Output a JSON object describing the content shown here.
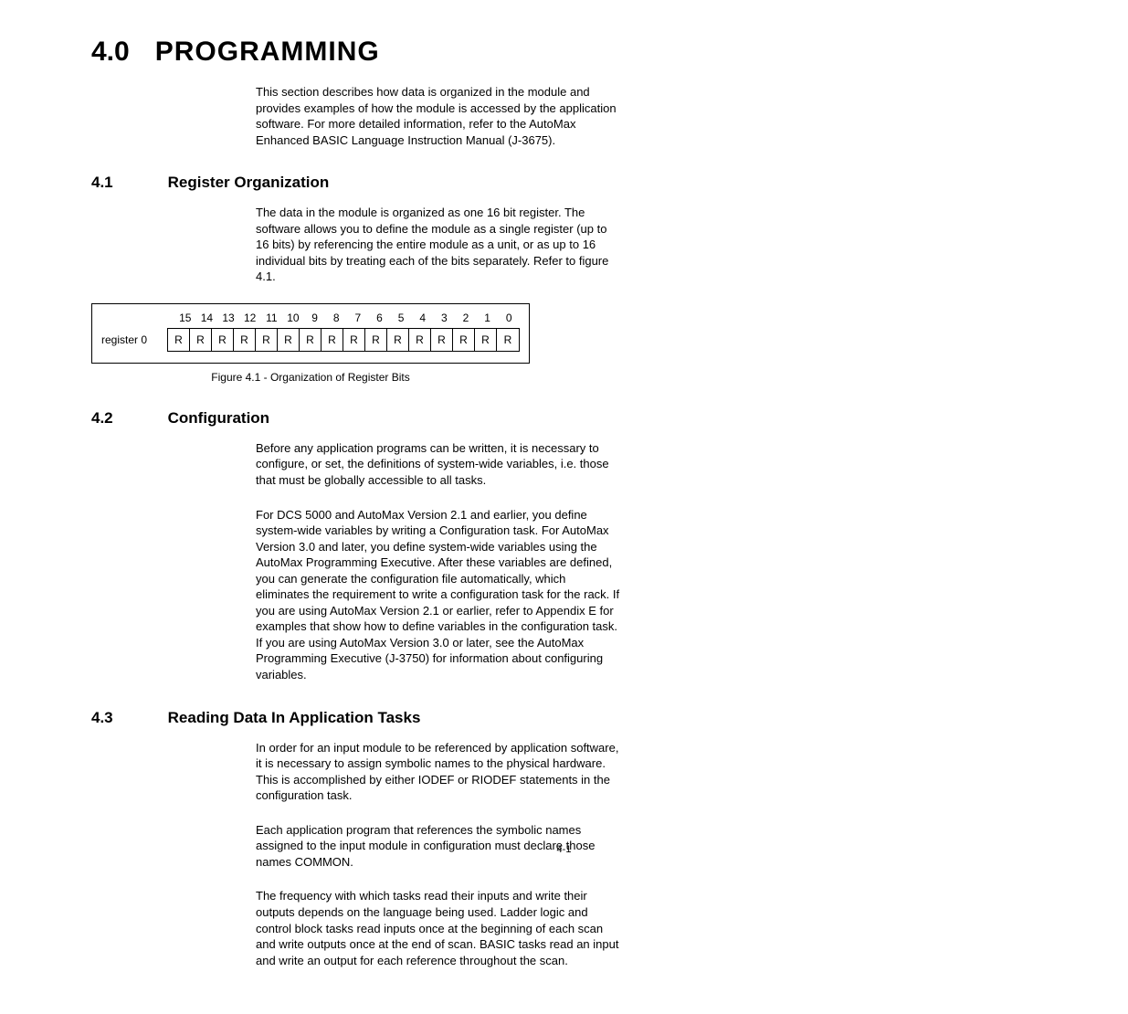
{
  "heading": {
    "number": "4.0",
    "title": "PROGRAMMING",
    "intro": "This section describes how data is organized in the module and provides examples of how the module is accessed by the application software. For more detailed information, refer to the AutoMax Enhanced BASIC Language Instruction Manual (J-3675)."
  },
  "section41": {
    "number": "4.1",
    "title": "Register Organization",
    "body": "The data in the module is organized as one 16 bit register. The software allows you to define the module as a single register (up to 16 bits) by referencing the entire module as a unit, or as up to 16 individual bits by treating each of the bits separately. Refer to figure 4.1."
  },
  "figure41": {
    "register_label": "register 0",
    "bits": [
      "15",
      "14",
      "13",
      "12",
      "11",
      "10",
      "9",
      "8",
      "7",
      "6",
      "5",
      "4",
      "3",
      "2",
      "1",
      "0"
    ],
    "cells": [
      "R",
      "R",
      "R",
      "R",
      "R",
      "R",
      "R",
      "R",
      "R",
      "R",
      "R",
      "R",
      "R",
      "R",
      "R",
      "R"
    ],
    "caption": "Figure 4.1 - Organization of Register Bits"
  },
  "section42": {
    "number": "4.2",
    "title": "Configuration",
    "p1": "Before any application programs can be written, it is necessary to configure, or set, the definitions of system-wide variables, i.e. those that must be globally accessible to all tasks.",
    "p2": "For DCS 5000 and AutoMax Version 2.1 and earlier, you define system-wide variables by writing a Configuration task. For AutoMax Version 3.0 and later, you define system-wide variables using the AutoMax Programming Executive. After these variables are defined, you can generate the configuration file automatically, which eliminates the requirement to write a configuration task for the rack. If you are using AutoMax Version 2.1 or earlier, refer to Appendix E for examples that show how to define variables in the configuration task. If you are using AutoMax Version 3.0 or later, see the AutoMax Programming Executive (J-3750) for information about configuring variables."
  },
  "section43": {
    "number": "4.3",
    "title": "Reading Data In Application Tasks",
    "p1": "In order for an input module to be referenced by application software, it is necessary to assign symbolic names to the physical hardware. This is accomplished by either IODEF or RIODEF statements in the configuration task.",
    "p2": "Each application program that references the symbolic names assigned to the input module in configuration must declare those names COMMON.",
    "p3": "The frequency with which tasks read their inputs and write their outputs depends on the language being used. Ladder logic and control block tasks read inputs once at the beginning of each scan and write outputs once at the end of scan. BASIC tasks read an input and write an output for each reference throughout the scan."
  },
  "page_number": "4-1",
  "chart_data": {
    "type": "table",
    "title": "Figure 4.1 - Organization of Register Bits",
    "categories": [
      "15",
      "14",
      "13",
      "12",
      "11",
      "10",
      "9",
      "8",
      "7",
      "6",
      "5",
      "4",
      "3",
      "2",
      "1",
      "0"
    ],
    "series": [
      {
        "name": "register 0",
        "values": [
          "R",
          "R",
          "R",
          "R",
          "R",
          "R",
          "R",
          "R",
          "R",
          "R",
          "R",
          "R",
          "R",
          "R",
          "R",
          "R"
        ]
      }
    ]
  }
}
